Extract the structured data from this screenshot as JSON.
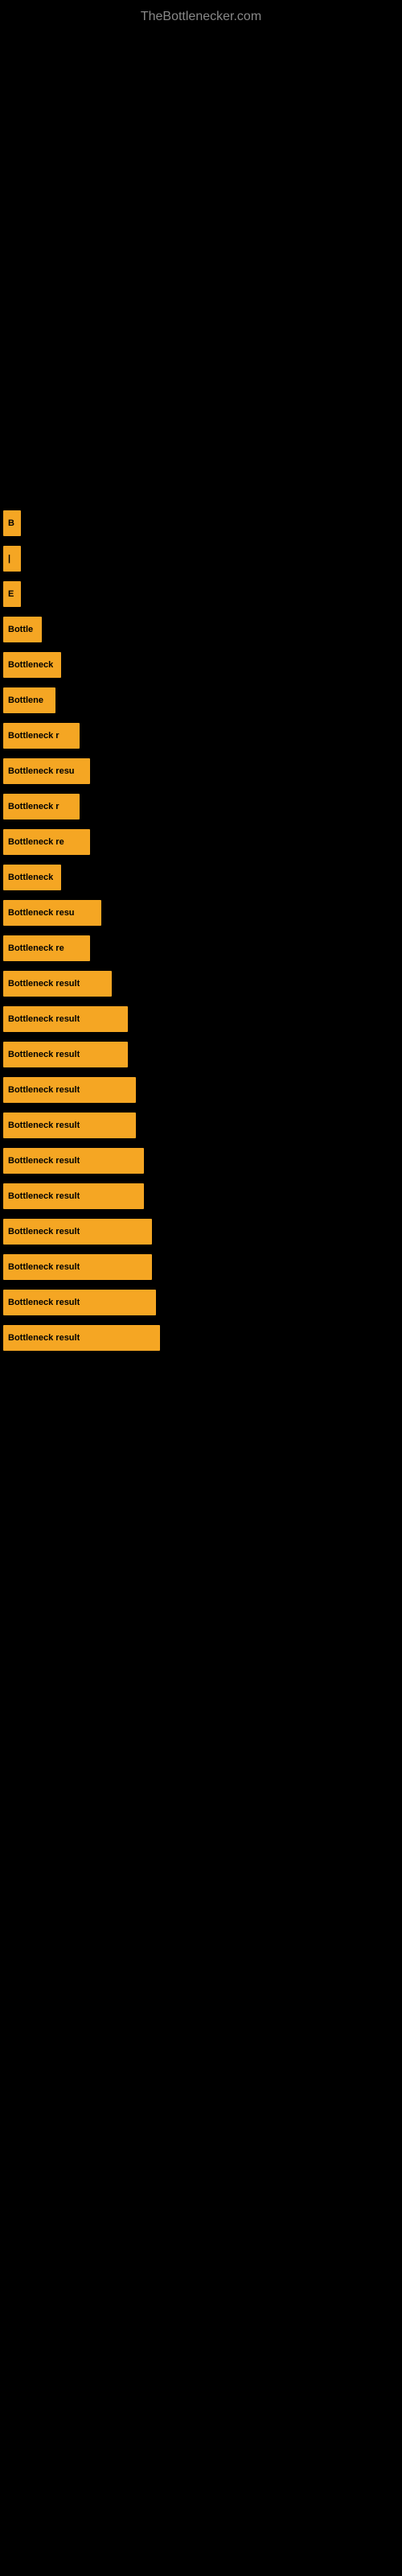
{
  "site": {
    "title": "TheBottlenecker.com"
  },
  "rows": [
    {
      "id": 1,
      "label": "B",
      "bar_class": "bar-w1"
    },
    {
      "id": 2,
      "label": "|",
      "bar_class": "bar-w2"
    },
    {
      "id": 3,
      "label": "E",
      "bar_class": "bar-w3"
    },
    {
      "id": 4,
      "label": "Bottle",
      "bar_class": "bar-w4"
    },
    {
      "id": 5,
      "label": "Bottleneck",
      "bar_class": "bar-w5"
    },
    {
      "id": 6,
      "label": "Bottlene",
      "bar_class": "bar-w6"
    },
    {
      "id": 7,
      "label": "Bottleneck r",
      "bar_class": "bar-w7"
    },
    {
      "id": 8,
      "label": "Bottleneck resu",
      "bar_class": "bar-w8"
    },
    {
      "id": 9,
      "label": "Bottleneck r",
      "bar_class": "bar-w9"
    },
    {
      "id": 10,
      "label": "Bottleneck re",
      "bar_class": "bar-w10"
    },
    {
      "id": 11,
      "label": "Bottleneck",
      "bar_class": "bar-w11"
    },
    {
      "id": 12,
      "label": "Bottleneck resu",
      "bar_class": "bar-w12"
    },
    {
      "id": 13,
      "label": "Bottleneck re",
      "bar_class": "bar-w13"
    },
    {
      "id": 14,
      "label": "Bottleneck result",
      "bar_class": "bar-w14"
    },
    {
      "id": 15,
      "label": "Bottleneck result",
      "bar_class": "bar-w15"
    },
    {
      "id": 16,
      "label": "Bottleneck result",
      "bar_class": "bar-w16"
    },
    {
      "id": 17,
      "label": "Bottleneck result",
      "bar_class": "bar-w17"
    },
    {
      "id": 18,
      "label": "Bottleneck result",
      "bar_class": "bar-w18"
    },
    {
      "id": 19,
      "label": "Bottleneck result",
      "bar_class": "bar-w19"
    },
    {
      "id": 20,
      "label": "Bottleneck result",
      "bar_class": "bar-w20"
    },
    {
      "id": 21,
      "label": "Bottleneck result",
      "bar_class": "bar-w21"
    },
    {
      "id": 22,
      "label": "Bottleneck result",
      "bar_class": "bar-w22"
    },
    {
      "id": 23,
      "label": "Bottleneck result",
      "bar_class": "bar-w23"
    },
    {
      "id": 24,
      "label": "Bottleneck result",
      "bar_class": "bar-w24"
    }
  ]
}
